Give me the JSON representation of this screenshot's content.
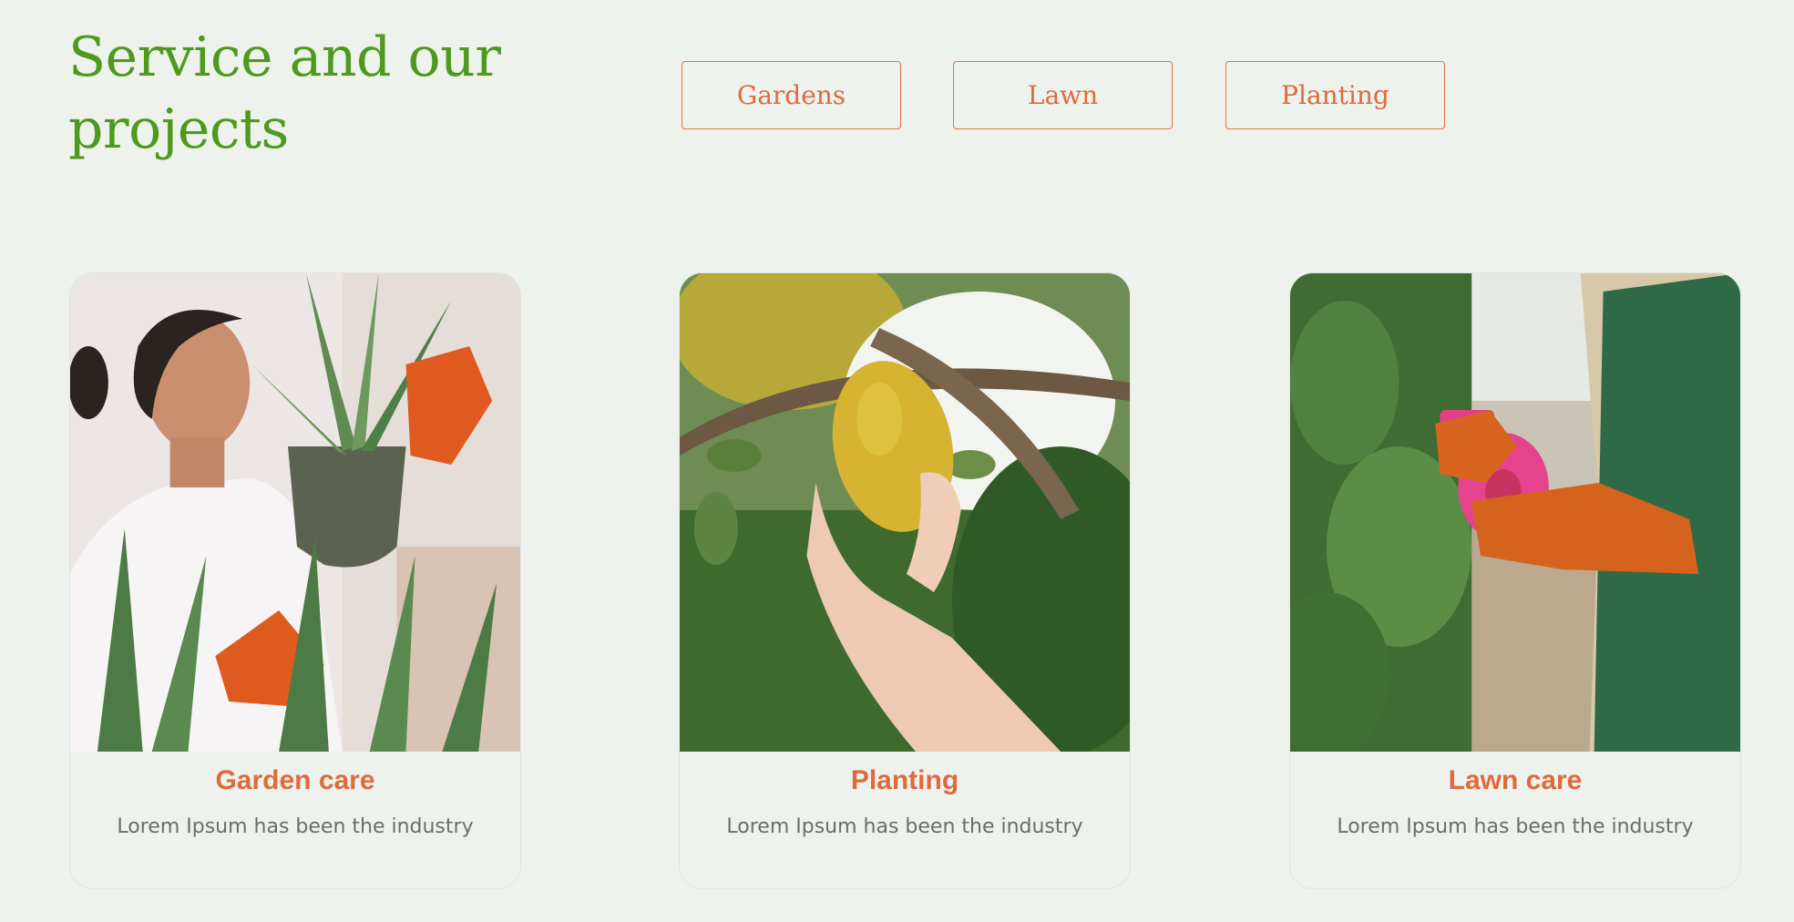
{
  "header": {
    "title_line1": "Service and our",
    "title_line2": "projects"
  },
  "filters": [
    {
      "label": "Gardens"
    },
    {
      "label": "Lawn"
    },
    {
      "label": "Planting"
    }
  ],
  "cards": [
    {
      "title": "Garden care",
      "text": "Lorem Ipsum has been the industry",
      "image": "woman-holding-aloe-plant-photo"
    },
    {
      "title": "Planting",
      "text": "Lorem Ipsum has been the industry",
      "image": "hand-picking-lemon-photo"
    },
    {
      "title": "Lawn care",
      "text": "Lorem Ipsum has been the industry",
      "image": "gloved-hands-spray-bottle-photo"
    }
  ],
  "colors": {
    "background": "#eef2ec",
    "title_green": "#4e9a1e",
    "accent_orange": "#df6a3c",
    "body_text": "#6c6c6c"
  }
}
